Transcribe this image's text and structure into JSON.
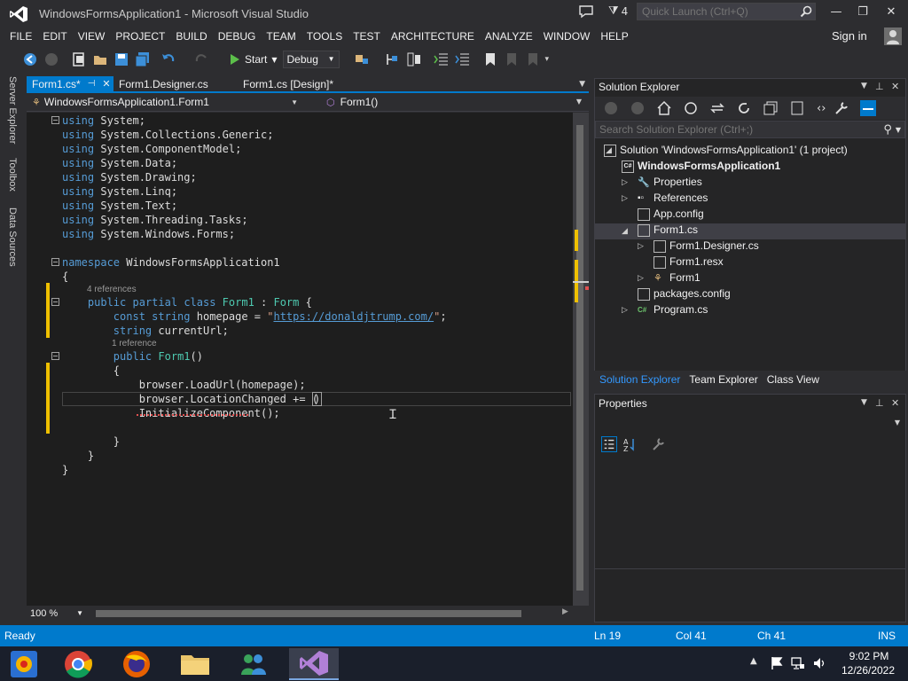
{
  "window": {
    "title": "WindowsFormsApplication1 - Microsoft Visual Studio",
    "notification_count": "4",
    "quick_launch_placeholder": "Quick Launch (Ctrl+Q)",
    "sign_in": "Sign in"
  },
  "menu": [
    "FILE",
    "EDIT",
    "VIEW",
    "PROJECT",
    "BUILD",
    "DEBUG",
    "TEAM",
    "TOOLS",
    "TEST",
    "ARCHITECTURE",
    "ANALYZE",
    "WINDOW",
    "HELP"
  ],
  "toolbar": {
    "start_label": "Start",
    "config": "Debug"
  },
  "left_tabs": [
    "Server Explorer",
    "Toolbox",
    "Data Sources"
  ],
  "doc_tabs": [
    {
      "label": "Form1.cs*",
      "active": true
    },
    {
      "label": "Form1.Designer.cs",
      "active": false
    },
    {
      "label": "Form1.cs [Design]*",
      "active": false
    }
  ],
  "nav": {
    "class": "WindowsFormsApplication1.Form1",
    "member": "Form1()"
  },
  "code": {
    "usings": [
      "System",
      "System.Collections.Generic",
      "System.ComponentModel",
      "System.Data",
      "System.Drawing",
      "System.Linq",
      "System.Text",
      "System.Threading.Tasks",
      "System.Windows.Forms"
    ],
    "namespace": "WindowsFormsApplication1",
    "class_refs": "4 references",
    "class_name": "Form1",
    "base_class": "Form",
    "homepage_var": "homepage",
    "homepage_url": "https://donaldjtrump.com/",
    "field_name": "currentUrl",
    "ctor_refs": "1 reference",
    "line_loadurl": "browser.LoadUrl(homepage);",
    "line_location": "browser.LocationChanged += (",
    "line_init": "InitializeComponent();"
  },
  "zoom": "100 %",
  "solution_explorer": {
    "title": "Solution Explorer",
    "search_placeholder": "Search Solution Explorer (Ctrl+;)",
    "items": [
      {
        "label": "Solution 'WindowsFormsApplication1' (1 project)"
      },
      {
        "label": "WindowsFormsApplication1"
      },
      {
        "label": "Properties"
      },
      {
        "label": "References"
      },
      {
        "label": "App.config"
      },
      {
        "label": "Form1.cs"
      },
      {
        "label": "Form1.Designer.cs"
      },
      {
        "label": "Form1.resx"
      },
      {
        "label": "Form1"
      },
      {
        "label": "packages.config"
      },
      {
        "label": "Program.cs"
      }
    ],
    "tabs": [
      "Solution Explorer",
      "Team Explorer",
      "Class View"
    ]
  },
  "properties": {
    "title": "Properties"
  },
  "status": {
    "state": "Ready",
    "ln": "Ln 19",
    "col": "Col 41",
    "ch": "Ch 41",
    "mode": "INS"
  },
  "taskbar": {
    "time": "9:02 PM",
    "date": "12/26/2022"
  },
  "colors": {
    "accent": "#007acc",
    "editor_bg": "#1e1e1e",
    "keyword": "#569cd6",
    "type": "#4ec9b0",
    "string": "#d69d85"
  }
}
